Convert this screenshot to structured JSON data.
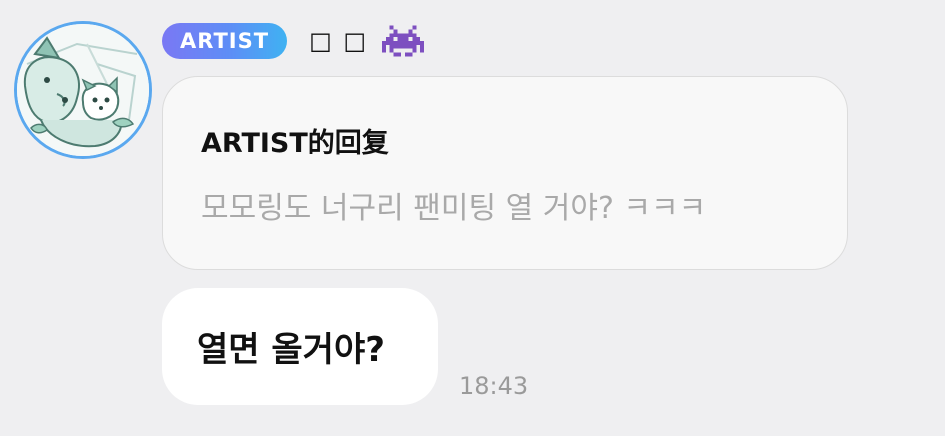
{
  "sender": {
    "badge": "ARTIST",
    "name": "□ □",
    "emoji_icon": "space-invader-icon"
  },
  "reply": {
    "title": "ARTIST的回复",
    "quoted_text": "모모링도 너구리 팬미팅 열 거야? ㅋㅋㅋ"
  },
  "message": {
    "text": "열면 올거야?",
    "time": "18:43"
  },
  "avatar": {
    "icon": "dog-illustration-avatar"
  },
  "colors": {
    "background": "#efeff1",
    "badge_gradient_start": "#7a78f4",
    "badge_gradient_end": "#3fb2f2",
    "avatar_ring": "#5aa8ef",
    "emoji_purple": "#7d4fc0",
    "quote_text": "#a9a9a9",
    "timestamp": "#9a9a9a"
  }
}
